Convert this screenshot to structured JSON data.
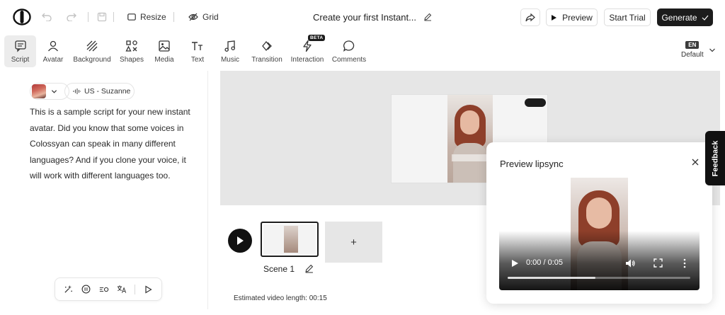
{
  "topbar": {
    "resize_label": "Resize",
    "grid_label": "Grid",
    "project_title": "Create your first Instant...",
    "preview_label": "Preview",
    "start_trial_label": "Start Trial",
    "generate_label": "Generate"
  },
  "toolbar": {
    "tools": [
      {
        "label": "Script",
        "icon": "script-icon",
        "active": true
      },
      {
        "label": "Avatar",
        "icon": "avatar-icon"
      },
      {
        "label": "Background",
        "icon": "background-icon"
      },
      {
        "label": "Shapes",
        "icon": "shapes-icon"
      },
      {
        "label": "Media",
        "icon": "media-icon"
      },
      {
        "label": "Text",
        "icon": "text-icon"
      },
      {
        "label": "Music",
        "icon": "music-icon"
      },
      {
        "label": "Transition",
        "icon": "transition-icon"
      },
      {
        "label": "Interaction",
        "icon": "interaction-icon",
        "badge": "BETA"
      },
      {
        "label": "Comments",
        "icon": "comments-icon"
      }
    ],
    "language": {
      "code": "EN",
      "label": "Default"
    }
  },
  "script": {
    "voice_label": "US - Suzanne",
    "text": "This is a sample script for your new instant avatar. Did you know that some voices in Colossyan can speak in many different languages? And if you clone your voice, it will work with different languages too."
  },
  "scenes": {
    "items": [
      {
        "label": "Scene 1"
      }
    ],
    "add_label": "+",
    "estimated_length": "Estimated video length: 00:15"
  },
  "lipsync": {
    "title": "Preview lipsync",
    "time": "0:00 / 0:05",
    "progress": 0.48
  },
  "feedback_label": "Feedback",
  "colors": {
    "accent": "#1c1c1c",
    "canvas_bg": "#e6e6e6"
  }
}
